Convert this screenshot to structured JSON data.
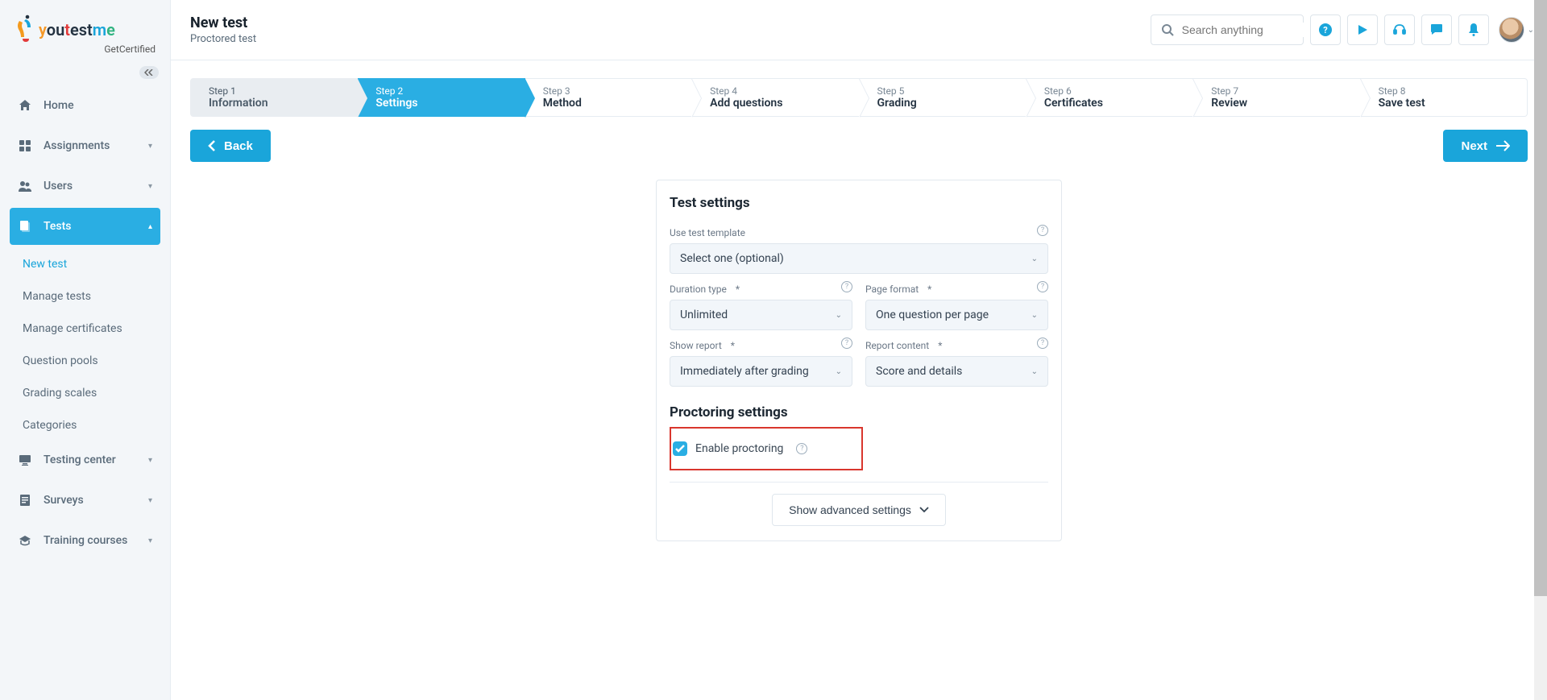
{
  "brand": {
    "name": "youtestme",
    "sub": "GetCertified"
  },
  "header": {
    "title": "New test",
    "subtitle": "Proctored test",
    "search_placeholder": "Search anything"
  },
  "sidebar": {
    "items": [
      {
        "label": "Home",
        "icon": "home"
      },
      {
        "label": "Assignments",
        "icon": "assignments",
        "expandable": true
      },
      {
        "label": "Users",
        "icon": "users",
        "expandable": true
      },
      {
        "label": "Tests",
        "icon": "tests",
        "expandable": true,
        "active": true
      },
      {
        "label": "Testing center",
        "icon": "monitor",
        "expandable": true
      },
      {
        "label": "Surveys",
        "icon": "surveys",
        "expandable": true
      },
      {
        "label": "Training courses",
        "icon": "training",
        "expandable": true
      }
    ],
    "tests_sub": [
      {
        "label": "New test",
        "active": true
      },
      {
        "label": "Manage tests"
      },
      {
        "label": "Manage certificates"
      },
      {
        "label": "Question pools"
      },
      {
        "label": "Grading scales"
      },
      {
        "label": "Categories"
      }
    ]
  },
  "wizard": [
    {
      "step": "Step 1",
      "title": "Information",
      "state": "done"
    },
    {
      "step": "Step 2",
      "title": "Settings",
      "state": "current"
    },
    {
      "step": "Step 3",
      "title": "Method"
    },
    {
      "step": "Step 4",
      "title": "Add questions"
    },
    {
      "step": "Step 5",
      "title": "Grading"
    },
    {
      "step": "Step 6",
      "title": "Certificates"
    },
    {
      "step": "Step 7",
      "title": "Review"
    },
    {
      "step": "Step 8",
      "title": "Save test"
    }
  ],
  "nav": {
    "back": "Back",
    "next": "Next"
  },
  "settings": {
    "title": "Test settings",
    "template_label": "Use test template",
    "template_value": "Select one (optional)",
    "duration_label": "Duration type",
    "duration_value": "Unlimited",
    "pageformat_label": "Page format",
    "pageformat_value": "One question per page",
    "showreport_label": "Show report",
    "showreport_value": "Immediately after grading",
    "reportcontent_label": "Report content",
    "reportcontent_value": "Score and details",
    "proctoring_title": "Proctoring settings",
    "enable_proctoring": "Enable proctoring",
    "advanced": "Show advanced settings"
  }
}
